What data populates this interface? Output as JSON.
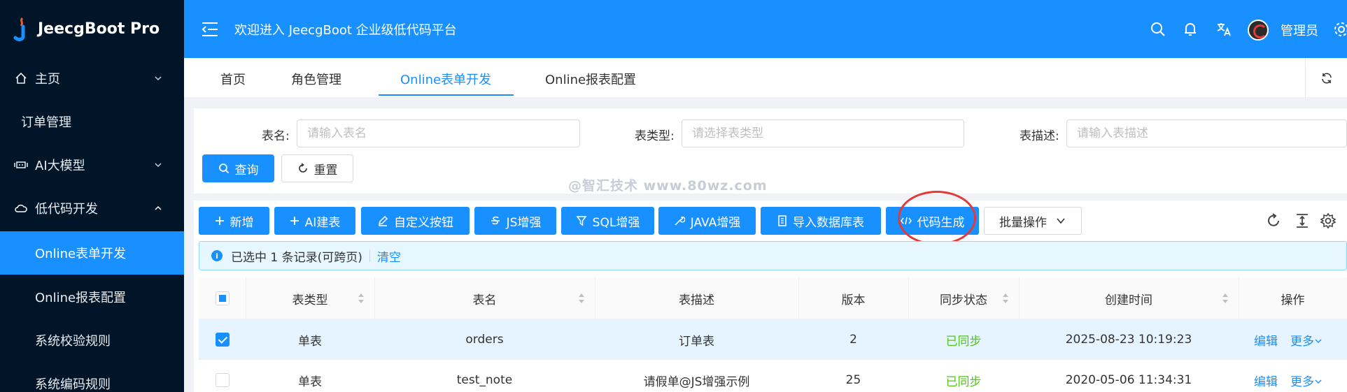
{
  "app": {
    "logo_text": "JeecgBoot Pro"
  },
  "sidebar": {
    "items": [
      {
        "label": "主页"
      },
      {
        "label": "订单管理"
      },
      {
        "label": "AI大模型"
      },
      {
        "label": "低代码开发"
      },
      {
        "label": "Online表单开发"
      },
      {
        "label": "Online报表配置"
      },
      {
        "label": "系统校验规则"
      },
      {
        "label": "系统编码规则"
      }
    ]
  },
  "header": {
    "welcome": "欢迎进入 JeecgBoot 企业级低代码平台",
    "username": "管理员"
  },
  "tabs": [
    {
      "label": "首页"
    },
    {
      "label": "角色管理"
    },
    {
      "label": "Online表单开发"
    },
    {
      "label": "Online报表配置"
    }
  ],
  "search": {
    "table_name_label": "表名:",
    "table_name_placeholder": "请输入表名",
    "table_type_label": "表类型:",
    "table_type_placeholder": "请选择表类型",
    "table_desc_label": "表描述:",
    "table_desc_placeholder": "请输入表描述",
    "query_label": "查询",
    "reset_label": "重置"
  },
  "watermark": "@智汇技术 www.80wz.com",
  "toolbar": {
    "add": "新增",
    "ai_create": "AI建表",
    "custom_button": "自定义按钮",
    "js_enhance": "JS增强",
    "sql_enhance": "SQL增强",
    "java_enhance": "JAVA增强",
    "import_db": "导入数据库表",
    "code_gen": "代码生成",
    "batch": "批量操作"
  },
  "alert": {
    "selected_text": "已选中 1 条记录(可跨页)",
    "clear": "清空"
  },
  "table": {
    "columns": [
      "表类型",
      "表名",
      "表描述",
      "版本",
      "同步状态",
      "创建时间",
      "操作"
    ],
    "rows": [
      {
        "type": "单表",
        "name": "orders",
        "desc": "订单表",
        "version": "2",
        "sync": "已同步",
        "created": "2025-08-23 10:19:23",
        "edit": "编辑",
        "more": "更多"
      },
      {
        "type": "单表",
        "name": "test_note",
        "desc": "请假单@JS增强示例",
        "version": "25",
        "sync": "已同步",
        "created": "2020-05-06 11:34:31",
        "edit": "编辑",
        "more": "更多"
      }
    ]
  },
  "colors": {
    "primary": "#1890ff",
    "sidebar_bg": "#011528",
    "success": "#52c41a",
    "highlight_circle": "#e23a3a"
  }
}
